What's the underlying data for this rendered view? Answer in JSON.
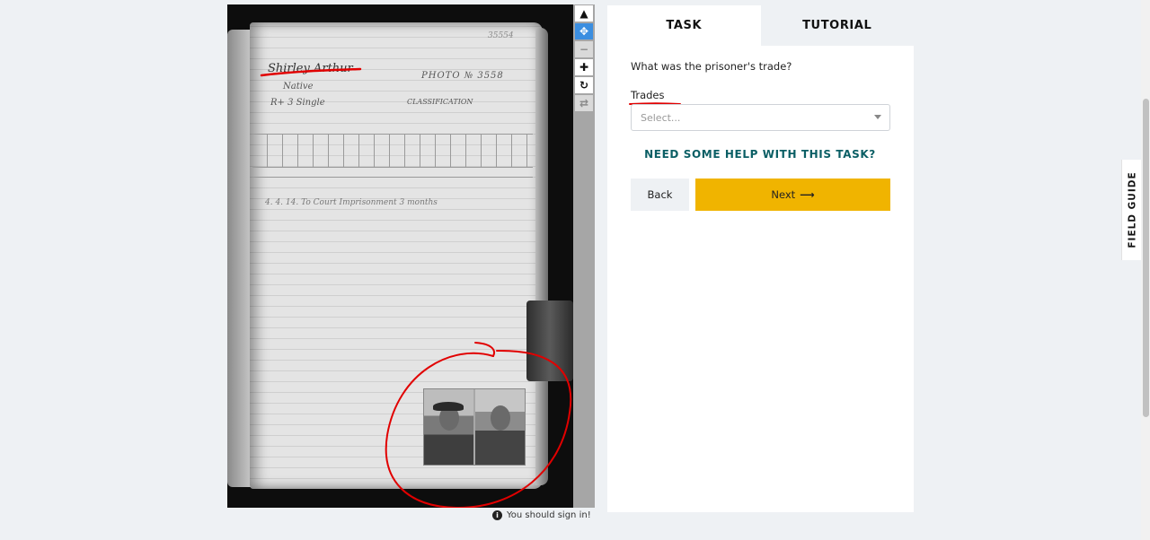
{
  "task_panel": {
    "tabs": [
      {
        "label": "TASK",
        "active": true
      },
      {
        "label": "TUTORIAL",
        "active": false
      }
    ],
    "question": "What was the prisoner's trade?",
    "field_label": "Trades",
    "select": {
      "placeholder": "Select..."
    },
    "help_link": "NEED SOME HELP WITH THIS TASK?",
    "back_label": "Back",
    "next_label": "Next"
  },
  "viewer": {
    "tools": [
      "pointer-icon",
      "move-icon",
      "zoom-out-icon",
      "zoom-in-icon",
      "rotate-icon",
      "reset-icon"
    ],
    "signin_message": "You should sign in!",
    "ledger": {
      "name": "Shirley Arthur",
      "nativity": "Native",
      "photo_no": "PHOTO № 3558",
      "status": "R+ 3  Single",
      "classification": "CLASSIFICATION",
      "folio": "35554",
      "entry": "4. 4. 14.   To Court   Imprisonment   3 months"
    }
  },
  "field_guide": {
    "label": "FIELD GUIDE"
  },
  "colors": {
    "accent": "#f0b400",
    "help": "#0b5f65",
    "annotation": "#e10000"
  }
}
